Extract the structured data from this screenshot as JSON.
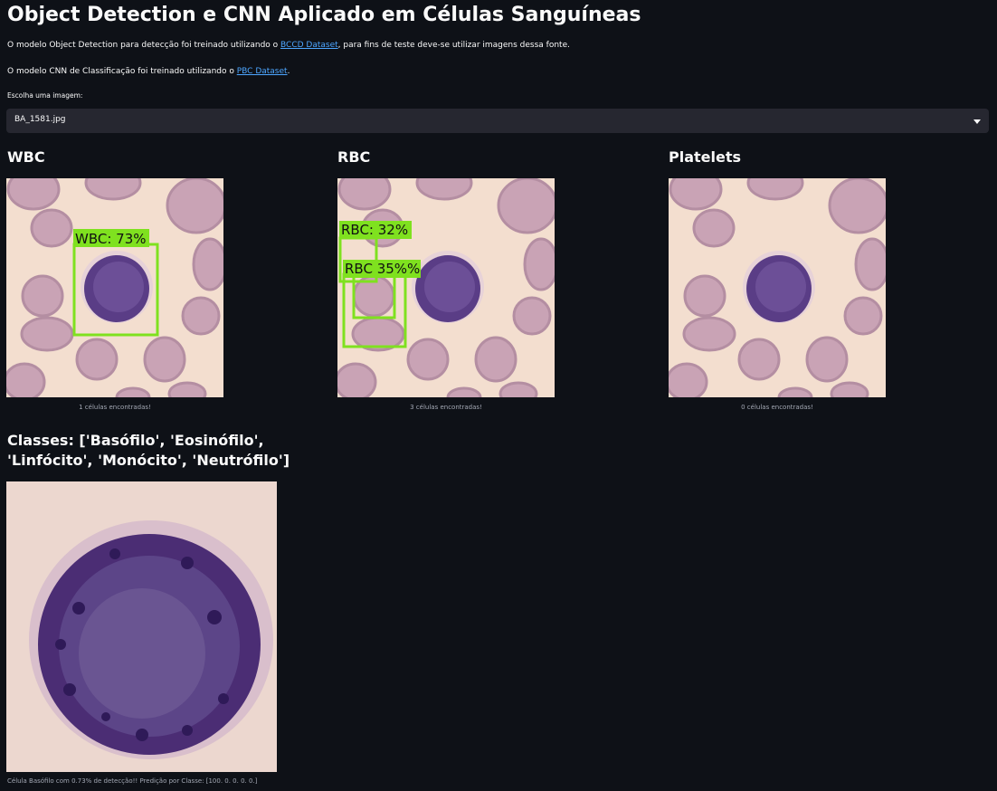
{
  "page": {
    "title": "Object Detection e CNN Aplicado em Células Sanguíneas",
    "intro1": {
      "before": "O modelo Object Detection para detecção foi treinado utilizando o ",
      "link": "BCCD Dataset",
      "after": ", para fins de teste deve-se utilizar imagens dessa fonte."
    },
    "intro2": {
      "before": "O modelo CNN de Classificação foi treinado utilizando o ",
      "link": "PBC Dataset",
      "after": "."
    }
  },
  "selector": {
    "label": "Escolha uma imagem:",
    "value": "BA_1581.jpg"
  },
  "columns": [
    {
      "heading": "WBC",
      "caption": "1 células encontradas!",
      "boxes": [
        {
          "label": "WBC: 73%"
        }
      ]
    },
    {
      "heading": "RBC",
      "caption": "3 células encontradas!",
      "boxes": [
        {
          "label": "RBC: 32%"
        },
        {
          "label": "RBC  35%%"
        }
      ]
    },
    {
      "heading": "Platelets",
      "caption": "0 células encontradas!",
      "boxes": []
    }
  ],
  "classification": {
    "heading": "Classes: ['Basófilo', 'Eosinófilo', 'Linfócito', 'Monócito', 'Neutrófilo']",
    "caption": "Célula Basófilo com 0.73% de detecção!! Predição por Classe: [100. 0. 0. 0. 0.]"
  },
  "colors": {
    "background": "#0e1117",
    "select_bg": "#262730",
    "link": "#4da6ff",
    "bbox": "#7fe11f"
  }
}
